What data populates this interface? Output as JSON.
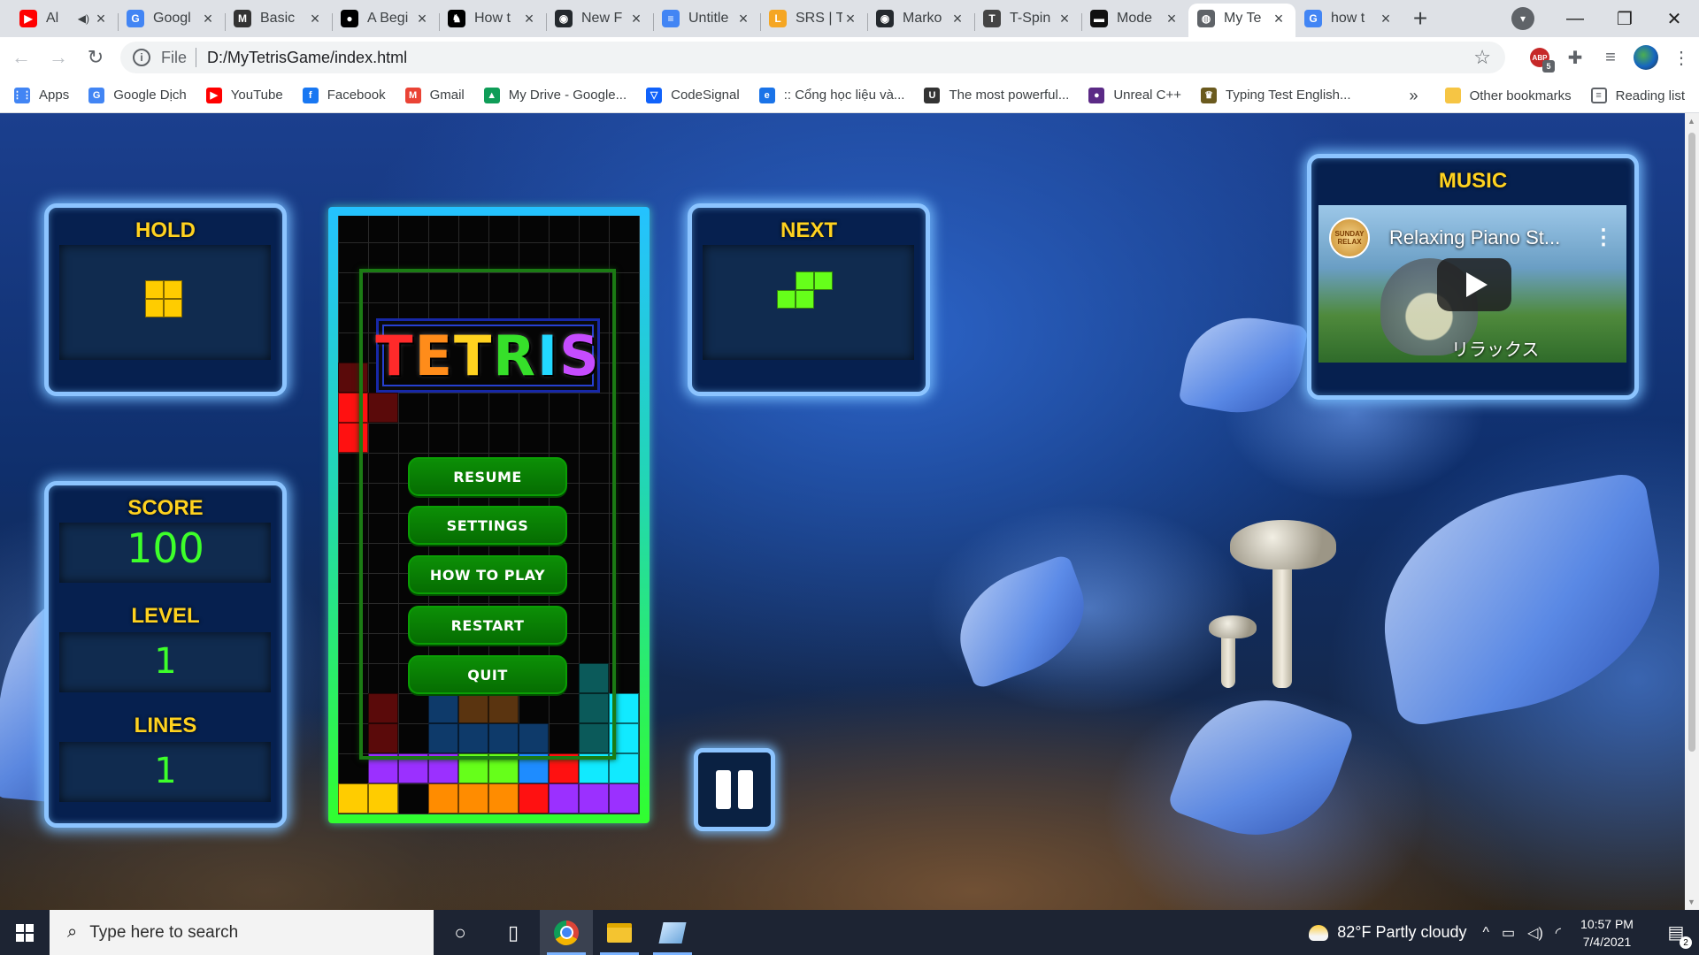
{
  "browser": {
    "tabs": [
      {
        "title": "Al",
        "favicon": "youtube-icon",
        "color": "#ff0000",
        "glyph": "▶",
        "muted": true
      },
      {
        "title": "Googl",
        "favicon": "google-translate-icon",
        "color": "#4285f4",
        "glyph": "G"
      },
      {
        "title": "Basic",
        "favicon": "md-icon",
        "color": "#333333",
        "glyph": "M"
      },
      {
        "title": "A Begi",
        "favicon": "medium-icon",
        "color": "#000000",
        "glyph": "●"
      },
      {
        "title": "How t",
        "favicon": "horse-icon",
        "color": "#000000",
        "glyph": "♞"
      },
      {
        "title": "New F",
        "favicon": "github-icon",
        "color": "#24292e",
        "glyph": "◉"
      },
      {
        "title": "Untitle",
        "favicon": "google-docs-icon",
        "color": "#4285f4",
        "glyph": "≡"
      },
      {
        "title": "SRS | T",
        "favicon": "srs-icon",
        "color": "#f5a623",
        "glyph": "L"
      },
      {
        "title": "Marko",
        "favicon": "github-icon",
        "color": "#24292e",
        "glyph": "◉"
      },
      {
        "title": "T-Spin",
        "favicon": "tspin-icon",
        "color": "#444444",
        "glyph": "T"
      },
      {
        "title": "Mode",
        "favicon": "mode-icon",
        "color": "#111111",
        "glyph": "▬"
      },
      {
        "title": "My Te",
        "favicon": "globe-icon",
        "color": "#5f6368",
        "glyph": "◍",
        "active": true
      },
      {
        "title": "how t",
        "favicon": "google-icon",
        "color": "#4285f4",
        "glyph": "G"
      }
    ],
    "new_tab_glyph": "+",
    "address": {
      "scheme": "File",
      "url": "D:/MyTetrisGame/index.html"
    },
    "extension_badge": "5",
    "extension_label": "ABP",
    "bookmarks": [
      {
        "label": "Apps",
        "icon": "apps-grid-icon",
        "color": "#4285f4",
        "glyph": "⋮⋮"
      },
      {
        "label": "Google Dịch",
        "icon": "google-translate-icon",
        "color": "#4285f4",
        "glyph": "G"
      },
      {
        "label": "YouTube",
        "icon": "youtube-icon",
        "color": "#ff0000",
        "glyph": "▶"
      },
      {
        "label": "Facebook",
        "icon": "facebook-icon",
        "color": "#1877f2",
        "glyph": "f"
      },
      {
        "label": "Gmail",
        "icon": "gmail-icon",
        "color": "#ea4335",
        "glyph": "M"
      },
      {
        "label": "My Drive - Google...",
        "icon": "google-drive-icon",
        "color": "#0f9d58",
        "glyph": "▲"
      },
      {
        "label": "CodeSignal",
        "icon": "codesignal-icon",
        "color": "#1062fb",
        "glyph": "▽"
      },
      {
        "label": ":: Cổng học liệu và...",
        "icon": "edu-portal-icon",
        "color": "#1a73e8",
        "glyph": "e"
      },
      {
        "label": "The most powerful...",
        "icon": "unreal-icon",
        "color": "#333333",
        "glyph": "U"
      },
      {
        "label": "Unreal C++",
        "icon": "unreal-cpp-icon",
        "color": "#5b2a86",
        "glyph": "●"
      },
      {
        "label": "Typing Test English...",
        "icon": "typing-test-icon",
        "color": "#6a5a1e",
        "glyph": "♛"
      }
    ],
    "bookmarks_overflow": "»",
    "other_bookmarks": "Other bookmarks",
    "reading_list": "Reading list"
  },
  "game": {
    "hold": {
      "title": "HOLD",
      "piece": "O",
      "color": "#ffcc00"
    },
    "next": {
      "title": "NEXT",
      "piece": "S",
      "color": "#66ff1a"
    },
    "stats": {
      "score_label": "SCORE",
      "score": "100",
      "level_label": "LEVEL",
      "level": "1",
      "lines_label": "LINES",
      "lines": "1"
    },
    "logo": {
      "letters": [
        {
          "ch": "T",
          "color": "#ff2a2a"
        },
        {
          "ch": "E",
          "color": "#ff8c1a"
        },
        {
          "ch": "T",
          "color": "#ffd21f"
        },
        {
          "ch": "R",
          "color": "#36e02a"
        },
        {
          "ch": "I",
          "color": "#22d8ff"
        },
        {
          "ch": "S",
          "color": "#c64cff"
        }
      ]
    },
    "menu": {
      "resume": "RESUME",
      "settings": "SETTINGS",
      "how_to_play": "HOW TO PLAY",
      "restart": "RESTART",
      "quit": "QUIT"
    },
    "board": {
      "cols": 10,
      "rows": 20,
      "colors": {
        "Y": "#ffcc00",
        "O": "#ff8c00",
        "R": "#ff1111",
        "P": "#9b30ff",
        "G": "#66ff1a",
        "B": "#1e8cff",
        "C": "#11eaff",
        "r": "#5a0a0a",
        "n": "#0e3a6a",
        "o": "#5a3410",
        "t": "#0b5a5a"
      },
      "cells": [
        "..........",
        "..........",
        "..........",
        "..........",
        "..........",
        "r.........",
        "Rr........",
        "R.........",
        "..........",
        "..........",
        "..........",
        "..........",
        "..........",
        "..........",
        "..........",
        "........t.",
        ".r.noo..tC",
        ".r.nnnn.tC",
        ".PPPGGBRCC",
        "YY.OOORPPP"
      ]
    },
    "music": {
      "title": "MUSIC",
      "video_title": "Relaxing Piano St...",
      "channel_badge": "SUNDAY RELAX",
      "caption_jp": "リラックス"
    },
    "pause_icon": "pause-icon"
  },
  "taskbar": {
    "search_placeholder": "Type here to search",
    "weather": "82°F  Partly cloudy",
    "time": "10:57 PM",
    "date": "7/4/2021",
    "notifications": "2"
  }
}
